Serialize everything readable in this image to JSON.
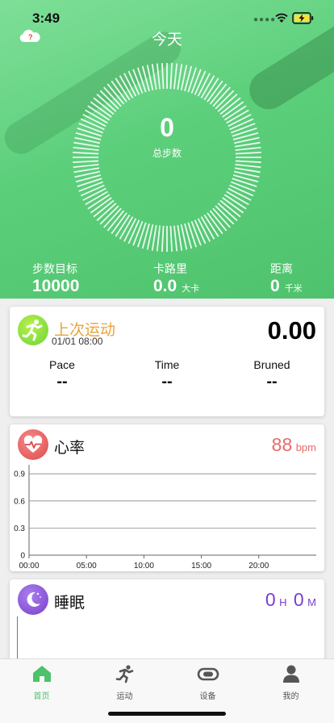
{
  "status_bar": {
    "time": "3:49"
  },
  "hero": {
    "title": "今天",
    "steps_value": "0",
    "steps_label": "总步数",
    "stats": [
      {
        "label": "步数目标",
        "value": "10000",
        "unit": ""
      },
      {
        "label": "卡路里",
        "value": "0.0",
        "unit": "大卡"
      },
      {
        "label": "距离",
        "value": "0",
        "unit": "千米"
      }
    ]
  },
  "last_workout": {
    "title": "上次运动",
    "date": "01/01 08:00",
    "total": "0.00",
    "metrics": [
      {
        "label": "Pace",
        "value": "--"
      },
      {
        "label": "Time",
        "value": "--"
      },
      {
        "label": "Bruned",
        "value": "--"
      }
    ]
  },
  "heart_rate": {
    "title": "心率",
    "value": "88",
    "unit": "bpm"
  },
  "chart_data": {
    "type": "line",
    "x": [
      "00:00",
      "05:00",
      "10:00",
      "15:00",
      "20:00"
    ],
    "yticks": [
      0,
      0.3,
      0.6,
      0.9
    ],
    "ylim": [
      0,
      1
    ],
    "series": [],
    "grid": true,
    "title": "",
    "xlabel": "",
    "ylabel": ""
  },
  "sleep": {
    "title": "睡眠",
    "hours": "0",
    "hours_unit": "H",
    "minutes": "0",
    "minutes_unit": "M"
  },
  "tabs": [
    {
      "label": "首页",
      "icon": "home-icon",
      "active": true
    },
    {
      "label": "运动",
      "icon": "running-icon",
      "active": false
    },
    {
      "label": "设备",
      "icon": "band-icon",
      "active": false
    },
    {
      "label": "我的",
      "icon": "person-icon",
      "active": false
    }
  ],
  "colors": {
    "accent_green": "#4cc26a",
    "workout_orange": "#e8a33a",
    "heart_red": "#e76a6a",
    "sleep_purple": "#7b3fc9"
  }
}
